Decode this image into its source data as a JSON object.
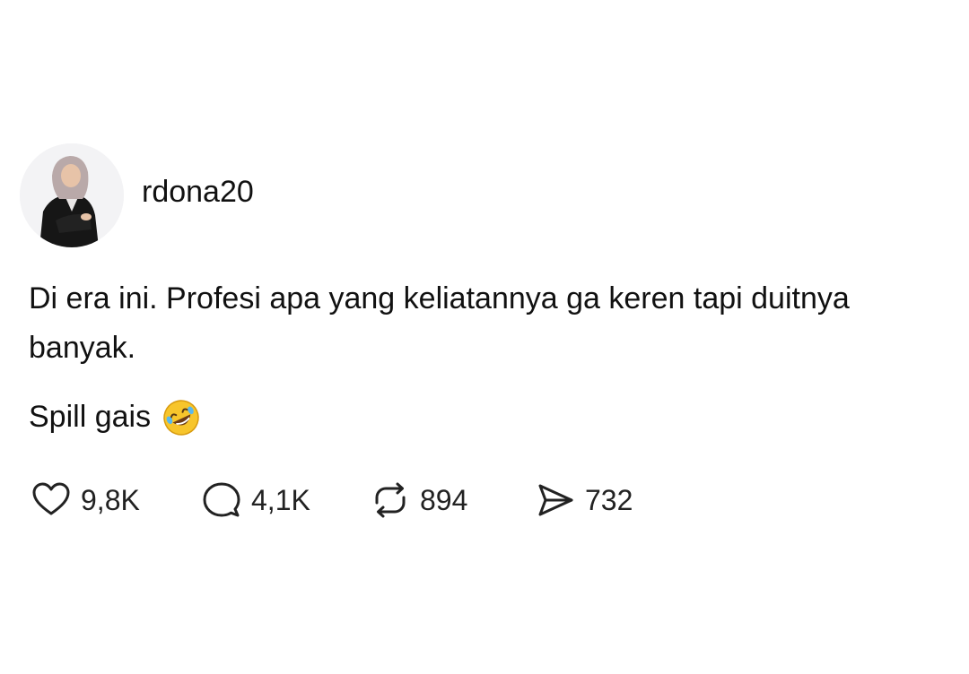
{
  "post": {
    "username": "rdona20",
    "text_line1": "Di era ini. Profesi apa yang keliatannya ga keren tapi duitnya banyak.",
    "text_line2": "Spill gais",
    "emoji": "rolling-on-floor-laughing-emoji"
  },
  "actions": {
    "likes": "9,8K",
    "replies": "4,1K",
    "reposts": "894",
    "shares": "732"
  },
  "icons": {
    "like": "heart-icon",
    "reply": "speech-bubble-icon",
    "repost": "repost-icon",
    "share": "send-icon"
  },
  "colors": {
    "text": "#111111",
    "icon": "#222222",
    "background": "#ffffff"
  }
}
